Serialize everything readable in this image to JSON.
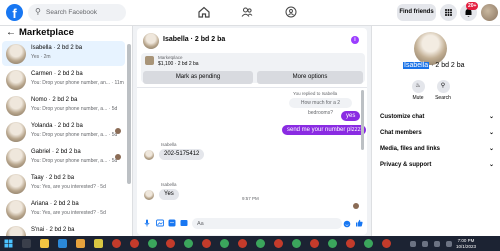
{
  "topbar": {
    "logo": "f",
    "search_placeholder": "Search Facebook",
    "find_friends": "Find friends",
    "notification_badge": "20+"
  },
  "marketplace": {
    "title": "Marketplace",
    "conversations": [
      {
        "name": "Isabella · 2 bd 2 ba",
        "snippet": "Yes · 2m",
        "active": true
      },
      {
        "name": "Carmen · 2 bd 2 ba",
        "snippet": "You: Drop your phone number, an... · 11m"
      },
      {
        "name": "Nomo · 2 bd 2 ba",
        "snippet": "You: Drop your phone number, a... · 5d"
      },
      {
        "name": "Yolanda · 2 bd 2 ba",
        "snippet": "You: Drop your phone number, a... · 5d"
      },
      {
        "name": "Gabriel · 2 bd 2 ba",
        "snippet": "You: Drop your phone number, a... · 5d"
      },
      {
        "name": "Taay · 2 bd 2 ba",
        "snippet": "You: Yes, are you interested? · 5d"
      },
      {
        "name": "Ariana · 2 bd 2 ba",
        "snippet": "You: Yes, are you interested? · 5d"
      },
      {
        "name": "S'nai · 2 bd 2 ba",
        "snippet": ""
      }
    ]
  },
  "chat": {
    "title": "Isabella · 2 bd 2 ba",
    "listing_label": "Marketplace",
    "listing_price": "$1,100 · 2 bd 2 ba",
    "mark_pending": "Mark as pending",
    "more_options": "More options",
    "reply_note": "You replied to Isabella",
    "reply_quote": "How much for a 2 bedrooms?",
    "msg_yes_out": "yes",
    "msg_number_out": "send me  your number plzzz",
    "sender_name_1": "Isabella",
    "msg_phone": "202-5175412",
    "timestamp": "9:57 PM",
    "sender_name_2": "Isabella",
    "msg_yes_in": "Yes",
    "input_placeholder": "Aa"
  },
  "profile": {
    "name_highlight": "Isabella",
    "name_rest": " · 2 bd 2 ba",
    "mute": "Mute",
    "search": "Search",
    "sections": [
      "Customize chat",
      "Chat members",
      "Media, files and links",
      "Privacy & support"
    ]
  },
  "taskbar": {
    "time": "7:00 PM",
    "date": "10/1/2023"
  },
  "colors": {
    "brand": "#1877f2",
    "outgoing_bubble": "#8a2be2",
    "active_item": "#e7f3ff",
    "badge": "#e41e3f"
  }
}
